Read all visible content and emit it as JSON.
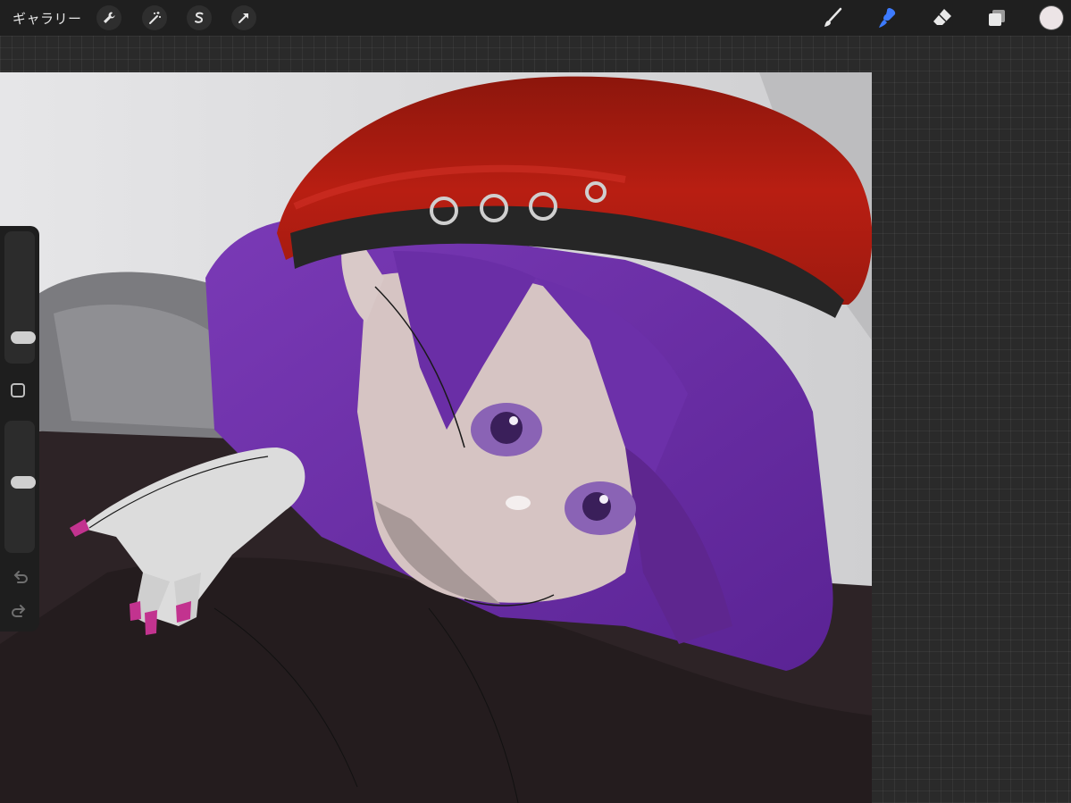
{
  "topbar": {
    "gallery_label": "ギャラリー",
    "left_tools": [
      {
        "icon": "wrench-icon",
        "name": "actions"
      },
      {
        "icon": "magic-wand-icon",
        "name": "adjustments"
      },
      {
        "icon": "selection-s-icon",
        "name": "selection"
      },
      {
        "icon": "arrow-cursor-icon",
        "name": "transform"
      }
    ],
    "right_tools": [
      {
        "icon": "brush-icon",
        "name": "paint"
      },
      {
        "icon": "smudge-icon",
        "name": "smudge",
        "active": true
      },
      {
        "icon": "eraser-icon",
        "name": "erase"
      },
      {
        "icon": "layers-icon",
        "name": "layers"
      }
    ],
    "active_color": "#ece4e6",
    "accent_color": "#3d7bff"
  },
  "sidebar": {
    "brush_size_level": 0.2,
    "opacity_level": 0.4,
    "modify_icon": "square-modify-icon",
    "undo_icon": "undo-icon",
    "redo_icon": "redo-icon"
  },
  "canvas": {
    "description_colors": {
      "hat": "#a81a10",
      "hair": "#6b2fa8",
      "skin": "#d9c8c6",
      "sweater": "#2a2022",
      "background": "#d6d6d8"
    }
  }
}
